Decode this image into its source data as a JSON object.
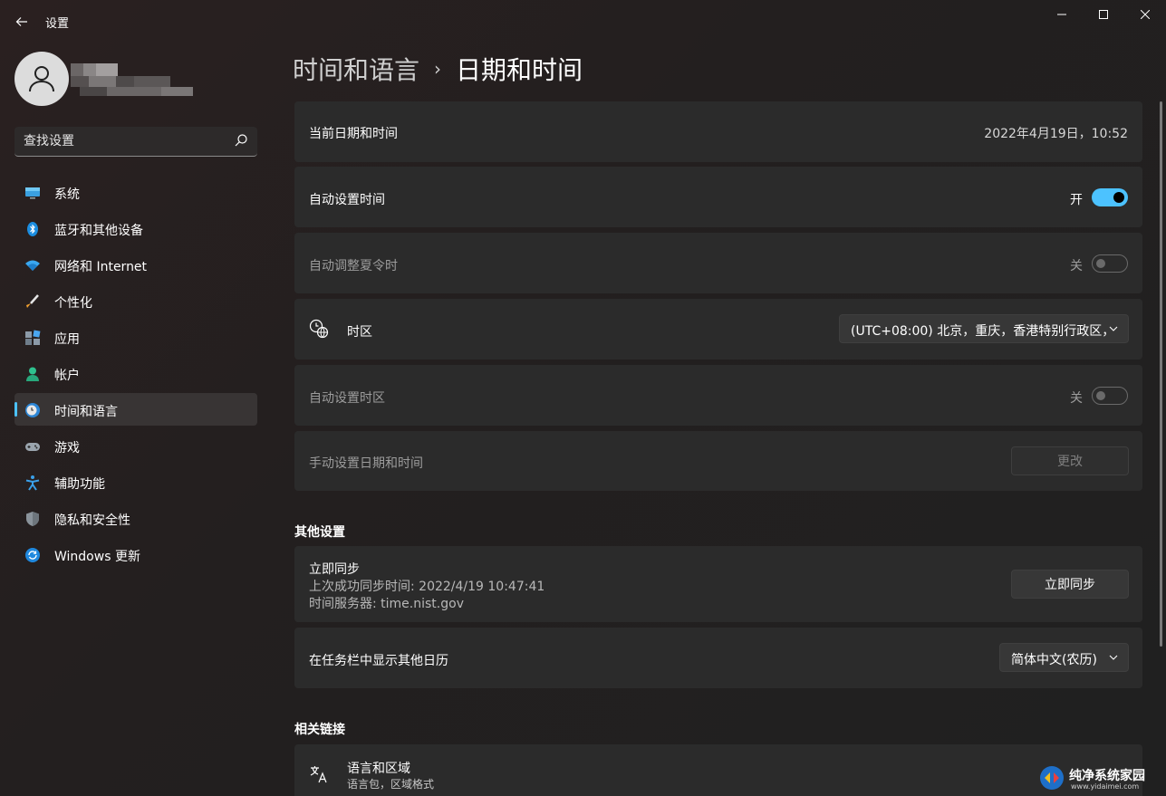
{
  "app": {
    "title": "设置"
  },
  "window_controls": {
    "minimize": "—",
    "maximize": "☐",
    "close": "✕"
  },
  "search": {
    "placeholder": "查找设置"
  },
  "sidebar": {
    "items": [
      {
        "label": "系统",
        "icon": "monitor-icon"
      },
      {
        "label": "蓝牙和其他设备",
        "icon": "bluetooth-icon"
      },
      {
        "label": "网络和 Internet",
        "icon": "wifi-icon"
      },
      {
        "label": "个性化",
        "icon": "brush-icon"
      },
      {
        "label": "应用",
        "icon": "apps-icon"
      },
      {
        "label": "帐户",
        "icon": "person-icon"
      },
      {
        "label": "时间和语言",
        "icon": "clock-globe-icon",
        "active": true
      },
      {
        "label": "游戏",
        "icon": "gamepad-icon"
      },
      {
        "label": "辅助功能",
        "icon": "accessibility-icon"
      },
      {
        "label": "隐私和安全性",
        "icon": "shield-icon"
      },
      {
        "label": "Windows 更新",
        "icon": "update-icon"
      }
    ]
  },
  "breadcrumb": {
    "parent": "时间和语言",
    "separator": "›",
    "current": "日期和时间"
  },
  "settings": {
    "current_datetime": {
      "label": "当前日期和时间",
      "value": "2022年4月19日，10:52"
    },
    "auto_time": {
      "label": "自动设置时间",
      "state": "开",
      "on": true
    },
    "auto_dst": {
      "label": "自动调整夏令时",
      "state": "关",
      "on": false
    },
    "timezone": {
      "label": "时区",
      "value": "(UTC+08:00) 北京，重庆，香港特别行政区，"
    },
    "auto_timezone": {
      "label": "自动设置时区",
      "state": "关",
      "on": false
    },
    "manual_datetime": {
      "label": "手动设置日期和时间",
      "button": "更改"
    }
  },
  "other_settings": {
    "title": "其他设置",
    "sync": {
      "label": "立即同步",
      "last_sync": "上次成功同步时间: 2022/4/19 10:47:41",
      "server": "时间服务器: time.nist.gov",
      "button": "立即同步"
    },
    "calendar": {
      "label": "在任务栏中显示其他日历",
      "value": "简体中文(农历)"
    }
  },
  "related_links": {
    "title": "相关链接",
    "language_region": {
      "label": "语言和区域",
      "sub": "语言包，区域格式"
    }
  },
  "watermark": {
    "text": "纯净系统家园",
    "url": "www.yidaimei.com"
  },
  "colors": {
    "accent": "#4cc2ff",
    "background": "#202020",
    "card": "#2b2b2b"
  }
}
